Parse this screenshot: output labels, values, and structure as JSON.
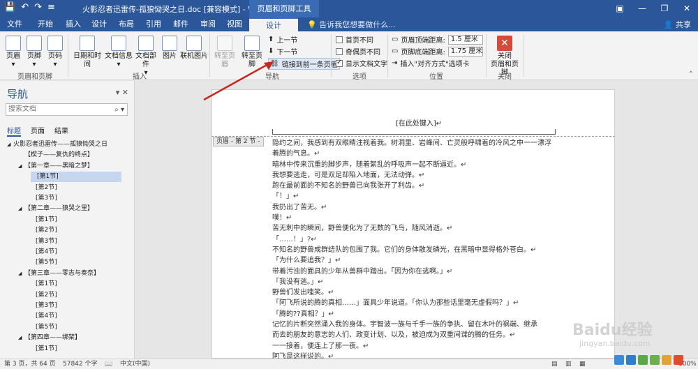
{
  "window": {
    "title": "火影忍者迅雷传-孤狼恸哭之日.doc [兼容模式] - Word",
    "context_tab_group": "页眉和页脚工具",
    "minimize": "—",
    "restore": "❐",
    "close": "✕",
    "ribbon_toggle": "▣"
  },
  "quick_access": {
    "save": "💾",
    "undo": "↶",
    "redo": "↷",
    "more": "≡"
  },
  "tabs": [
    "文件",
    "开始",
    "插入",
    "设计",
    "布局",
    "引用",
    "邮件",
    "审阅",
    "视图",
    "设计"
  ],
  "tell_me": "告诉我您想要做什么...",
  "share": "共享",
  "ribbon": {
    "header_footer_group": {
      "label": "页眉和页脚",
      "header": "页眉",
      "footer": "页脚",
      "page_number": "页码"
    },
    "insert_group": {
      "label": "插入",
      "date_time": "日期和时间",
      "doc_info": "文档信息",
      "doc_parts": "文档部件",
      "picture": "图片",
      "online_picture": "联机图片"
    },
    "navigation_group": {
      "label": "导航",
      "goto_header": "转至页眉",
      "goto_footer": "转至页脚",
      "prev_section": "上一节",
      "next_section": "下一节",
      "link_previous": "链接到前一条页眉"
    },
    "options_group": {
      "label": "选项",
      "different_first": "首页不同",
      "different_odd_even": "奇偶页不同",
      "show_doc_text": "显示文档文字"
    },
    "position_group": {
      "label": "位置",
      "header_from_top_label": "页眉顶端距离:",
      "header_from_top": "1.5 厘米",
      "footer_from_bottom_label": "页脚底端距离:",
      "footer_from_bottom": "1.75 厘米",
      "insert_align_tab": "插入\"对齐方式\"选项卡"
    },
    "close_group": {
      "label": "关闭",
      "close": "关闭\n页眉和页脚"
    }
  },
  "nav_pane": {
    "title": "导航",
    "search_placeholder": "搜索文档",
    "tabs": [
      "标题",
      "页面",
      "结果"
    ],
    "tree": [
      {
        "text": "火影忍者迅雷传——孤狼恸哭之日",
        "level": 0,
        "arrow": "◢"
      },
      {
        "text": "【楔子——复仇的终点】",
        "level": 1,
        "arrow": ""
      },
      {
        "text": "【第一章——黑暗之梦】",
        "level": 1,
        "arrow": "◢"
      },
      {
        "text": "[第1节]",
        "level": 2,
        "arrow": "",
        "selected": true
      },
      {
        "text": "[第2节]",
        "level": 2,
        "arrow": ""
      },
      {
        "text": "[第3节]",
        "level": 2,
        "arrow": ""
      },
      {
        "text": "【第二章——狼哭之里】",
        "level": 1,
        "arrow": "◢"
      },
      {
        "text": "[第1节]",
        "level": 2,
        "arrow": ""
      },
      {
        "text": "[第2节]",
        "level": 2,
        "arrow": ""
      },
      {
        "text": "[第3节]",
        "level": 2,
        "arrow": ""
      },
      {
        "text": "[第4节]",
        "level": 2,
        "arrow": ""
      },
      {
        "text": "[第5节]",
        "level": 2,
        "arrow": ""
      },
      {
        "text": "【第三章——零志与奏奈】",
        "level": 1,
        "arrow": "◢"
      },
      {
        "text": "[第1节]",
        "level": 2,
        "arrow": ""
      },
      {
        "text": "[第2节]",
        "level": 2,
        "arrow": ""
      },
      {
        "text": "[第3节]",
        "level": 2,
        "arrow": ""
      },
      {
        "text": "[第4节]",
        "level": 2,
        "arrow": ""
      },
      {
        "text": "[第5节]",
        "level": 2,
        "arrow": ""
      },
      {
        "text": "【第四章——绑架】",
        "level": 1,
        "arrow": "◢"
      },
      {
        "text": "[第1节]",
        "level": 2,
        "arrow": ""
      }
    ]
  },
  "document": {
    "header_placeholder": "[在此处键入]↵",
    "header_tag": "页眉 - 第 2 节 -",
    "lines": [
      "隐约之间，我感到有双眼睛注视着我。树洞里、岩峰间、亡灵般呼啸着的冷风之中一一漂浮",
      "着腾的气息。↵",
      "暗林中传来沉重的脚步声，随着絮乱的呼吸声一起不断逼近。↵",
      "我想要逃走，可是双足却陷入地面，无法动弹。↵",
      "跑在最前面的不知名的野兽已向我张开了利齿。↵",
      "「！」↵",
      "我扔出了苦无。↵",
      "噗！↵",
      "苦无刺中的瞬间，野兽便化为了无数的飞鸟，随风消逝。↵",
      "「……！」?↵",
      "不知名的野兽成群结队的包围了我。它们的身体散发磷光，在黑暗中显得格外苍白。↵",
      "「为什么要追我？」↵",
      "带着污浊的面具的少年从兽群中踏出。「因为你在逃啊。」↵",
      "「我没有逃。」↵",
      "野兽们发出嗤笑。↵",
      "「阿飞所说的腾的真相……」面具少年说道。「你认为那些话里毫无虚假吗？」↵",
      "「腾的??真相？」↵",
      "记忆的片断突然涌入我的身体。宇智波一族与千手一族的争执、留在木叶的祸端、继承",
      "而去的朋友的意志的人们、政变计划、以及，被迫成为双重间谍的腾的任务。↵",
      "一一接着，便连上了那一夜。↵",
      "阿飞是这样说的。↵"
    ]
  },
  "status_bar": {
    "page": "第 3 页，共 64 页",
    "words": "57842 个字",
    "lang": "中文(中国)",
    "zoom": "100%"
  },
  "watermark": {
    "main": "Baidu经验",
    "sub": "jingyan.baidu.com"
  }
}
